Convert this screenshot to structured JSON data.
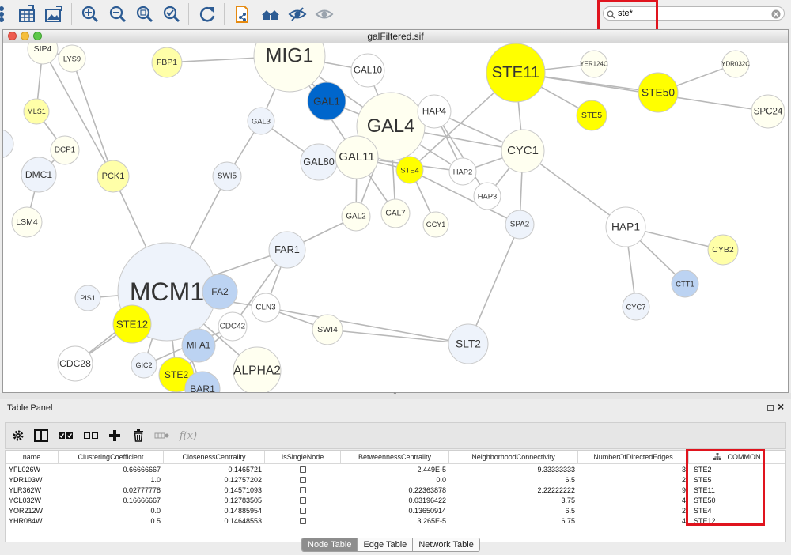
{
  "search": {
    "value": "ste*",
    "placeholder": ""
  },
  "network_window": {
    "title": "galFiltered.sif"
  },
  "colors": {
    "yellow": "#ffff00",
    "pale_yellow": "#ffffa8",
    "cream": "#fffff0",
    "pale_blue": "#eef3fb",
    "light_blue": "#bcd3f2",
    "blue": "#0066cc",
    "white": "#ffffff"
  },
  "network": {
    "nodes": [
      {
        "id": "SIP4",
        "label": "SIP4",
        "color": "cream"
      },
      {
        "id": "LYS9",
        "label": "LYS9",
        "color": "cream"
      },
      {
        "id": "FBP1",
        "label": "FBP1",
        "color": "pale_yellow"
      },
      {
        "id": "MIG1",
        "label": "MIG1",
        "color": "cream"
      },
      {
        "id": "GAL10",
        "label": "GAL10",
        "color": "white"
      },
      {
        "id": "GAL1",
        "label": "GAL1",
        "color": "blue"
      },
      {
        "id": "GAL4",
        "label": "GAL4",
        "color": "cream"
      },
      {
        "id": "HAP4",
        "label": "HAP4",
        "color": "white"
      },
      {
        "id": "GAL3",
        "label": "GAL3",
        "color": "pale_blue"
      },
      {
        "id": "GAL80",
        "label": "GAL80",
        "color": "pale_blue"
      },
      {
        "id": "GAL11",
        "label": "GAL11",
        "color": "cream"
      },
      {
        "id": "STE4",
        "label": "STE4",
        "color": "yellow"
      },
      {
        "id": "HAP2",
        "label": "HAP2",
        "color": "white"
      },
      {
        "id": "HAP3",
        "label": "HAP3",
        "color": "white"
      },
      {
        "id": "CYC1",
        "label": "CYC1",
        "color": "cream"
      },
      {
        "id": "STE11",
        "label": "STE11",
        "color": "yellow"
      },
      {
        "id": "YER124C",
        "label": "YER124C",
        "color": "cream"
      },
      {
        "id": "YDR032C",
        "label": "YDR032C",
        "color": "cream"
      },
      {
        "id": "STE50",
        "label": "STE50",
        "color": "yellow"
      },
      {
        "id": "STE5",
        "label": "STE5",
        "color": "yellow"
      },
      {
        "id": "SPC24",
        "label": "SPC24",
        "color": "cream"
      },
      {
        "id": "MLS1",
        "label": "MLS1",
        "color": "pale_yellow"
      },
      {
        "id": "DCP1",
        "label": "DCP1",
        "color": "cream"
      },
      {
        "id": "DMC1",
        "label": "DMC1",
        "color": "pale_blue"
      },
      {
        "id": "PCK1",
        "label": "PCK1",
        "color": "pale_yellow"
      },
      {
        "id": "SWI5",
        "label": "SWI5",
        "color": "pale_blue"
      },
      {
        "id": "LSM4",
        "label": "LSM4",
        "color": "cream"
      },
      {
        "id": "GAL2",
        "label": "GAL2",
        "color": "cream"
      },
      {
        "id": "GAL7",
        "label": "GAL7",
        "color": "cream"
      },
      {
        "id": "GCY1",
        "label": "GCY1",
        "color": "cream"
      },
      {
        "id": "SPA2",
        "label": "SPA2",
        "color": "pale_blue"
      },
      {
        "id": "HAP1",
        "label": "HAP1",
        "color": "white"
      },
      {
        "id": "CYB2",
        "label": "CYB2",
        "color": "pale_yellow"
      },
      {
        "id": "FAR1",
        "label": "FAR1",
        "color": "pale_blue"
      },
      {
        "id": "MCM1",
        "label": "MCM1",
        "color": "pale_blue"
      },
      {
        "id": "MFA2",
        "label": "FA2",
        "color": "light_blue"
      },
      {
        "id": "PIS1",
        "label": "PIS1",
        "color": "pale_blue"
      },
      {
        "id": "STE12",
        "label": "STE12",
        "color": "yellow"
      },
      {
        "id": "CLN3",
        "label": "CLN3",
        "color": "white"
      },
      {
        "id": "CDC42",
        "label": "CDC42",
        "color": "white"
      },
      {
        "id": "MFA1",
        "label": "MFA1",
        "color": "light_blue"
      },
      {
        "id": "SWI4",
        "label": "SWI4",
        "color": "cream"
      },
      {
        "id": "SLT2",
        "label": "SLT2",
        "color": "pale_blue"
      },
      {
        "id": "CTT1",
        "label": "CTT1",
        "color": "light_blue"
      },
      {
        "id": "CYC7",
        "label": "CYC7",
        "color": "pale_blue"
      },
      {
        "id": "CDC28",
        "label": "CDC28",
        "color": "white"
      },
      {
        "id": "GIC2",
        "label": "GIC2",
        "color": "pale_blue"
      },
      {
        "id": "STE2",
        "label": "STE2",
        "color": "yellow"
      },
      {
        "id": "ALPHA2",
        "label": "ALPHA2",
        "color": "cream"
      },
      {
        "id": "BAR1",
        "label": "BAR1",
        "color": "light_blue"
      },
      {
        "id": "B_partial",
        "label": "B",
        "color": "pale_blue"
      }
    ],
    "edges": [
      [
        "SIP4",
        "LYS9"
      ],
      [
        "MIG1",
        "GAL10"
      ],
      [
        "MIG1",
        "GAL1"
      ],
      [
        "MIG1",
        "GAL4"
      ],
      [
        "MIG1",
        "GAL3"
      ],
      [
        "MIG1",
        "GAL11"
      ],
      [
        "GAL4",
        "GAL1"
      ],
      [
        "GAL4",
        "GAL10"
      ],
      [
        "GAL4",
        "HAP4"
      ],
      [
        "GAL4",
        "GAL80"
      ],
      [
        "GAL4",
        "GAL11"
      ],
      [
        "GAL4",
        "STE4"
      ],
      [
        "GAL4",
        "GAL2"
      ],
      [
        "GAL4",
        "GAL7"
      ],
      [
        "GAL4",
        "GCY1"
      ],
      [
        "GAL4",
        "CYC1"
      ],
      [
        "GAL4",
        "HAP2"
      ],
      [
        "GAL11",
        "GAL80"
      ],
      [
        "GAL11",
        "GAL2"
      ],
      [
        "GAL11",
        "GAL7"
      ],
      [
        "GAL11",
        "STE4"
      ],
      [
        "GAL11",
        "HAP2"
      ],
      [
        "HAP4",
        "HAP2"
      ],
      [
        "HAP4",
        "HAP3"
      ],
      [
        "HAP4",
        "CYC1"
      ],
      [
        "HAP2",
        "CYC1"
      ],
      [
        "HAP3",
        "CYC1"
      ],
      [
        "CYC1",
        "HAP1"
      ],
      [
        "CYC1",
        "SPA2"
      ],
      [
        "CYC1",
        "STE11"
      ],
      [
        "STE11",
        "STE5"
      ],
      [
        "STE11",
        "STE50"
      ],
      [
        "STE11",
        "YER124C"
      ],
      [
        "STE11",
        "SPC24"
      ],
      [
        "STE11",
        "STE4"
      ],
      [
        "STE50",
        "YDR032C"
      ],
      [
        "HAP1",
        "CYB2"
      ],
      [
        "HAP1",
        "CTT1"
      ],
      [
        "HAP1",
        "CYC7"
      ],
      [
        "SPA2",
        "SLT2"
      ],
      [
        "FAR1",
        "MCM1"
      ],
      [
        "FAR1",
        "CLN3"
      ],
      [
        "FAR1",
        "GAL2"
      ],
      [
        "FAR1",
        "CDC42"
      ],
      [
        "MCM1",
        "SWI5"
      ],
      [
        "MCM1",
        "PCK1"
      ],
      [
        "MCM1",
        "MFA2"
      ],
      [
        "MCM1",
        "STE12"
      ],
      [
        "MCM1",
        "PIS1"
      ],
      [
        "MCM1",
        "CLN3"
      ],
      [
        "MCM1",
        "MFA1"
      ],
      [
        "MCM1",
        "STE2"
      ],
      [
        "MCM1",
        "ALPHA2"
      ],
      [
        "MCM1",
        "BAR1"
      ],
      [
        "MCM1",
        "CDC28"
      ],
      [
        "MCM1",
        "GIC2"
      ],
      [
        "CLN3",
        "SWI4"
      ],
      [
        "CLN3",
        "SLT2"
      ],
      [
        "SWI4",
        "SLT2"
      ],
      [
        "CDC42",
        "STE2"
      ],
      [
        "CDC42",
        "GIC2"
      ],
      [
        "STE12",
        "CDC28"
      ],
      [
        "DCP1",
        "DMC1"
      ],
      [
        "DMC1",
        "LSM4"
      ],
      [
        "MLS1",
        "DCP1"
      ],
      [
        "SIP4",
        "MLS1"
      ],
      [
        "SIP4",
        "PCK1"
      ],
      [
        "LYS9",
        "PCK1"
      ],
      [
        "FBP1",
        "MIG1"
      ],
      [
        "SWI5",
        "GAL3"
      ],
      [
        "GAL3",
        "GAL80"
      ],
      [
        "SPA2",
        "STE4"
      ]
    ]
  },
  "table_panel": {
    "title": "Table Panel",
    "columns": [
      "name",
      "ClusteringCoefficient",
      "ClosenessCentrality",
      "IsSingleNode",
      "BetweennessCentrality",
      "NeighborhoodConnectivity",
      "NumberOfDirectedEdges",
      "COMMON"
    ],
    "rows": [
      {
        "name": "YFL026W",
        "cc": "0.66666667",
        "clos": "0.1465721",
        "single": false,
        "betw": "2.449E-5",
        "nconn": "9.33333333",
        "nde": "3",
        "common": "STE2"
      },
      {
        "name": "YDR103W",
        "cc": "1.0",
        "clos": "0.12757202",
        "single": false,
        "betw": "0.0",
        "nconn": "6.5",
        "nde": "2",
        "common": "STE5"
      },
      {
        "name": "YLR362W",
        "cc": "0.02777778",
        "clos": "0.14571093",
        "single": false,
        "betw": "0.22363878",
        "nconn": "2.22222222",
        "nde": "9",
        "common": "STE11"
      },
      {
        "name": "YCL032W",
        "cc": "0.16666667",
        "clos": "0.12783505",
        "single": false,
        "betw": "0.03196422",
        "nconn": "3.75",
        "nde": "4",
        "common": "STE50"
      },
      {
        "name": "YOR212W",
        "cc": "0.0",
        "clos": "0.14885954",
        "single": false,
        "betw": "0.13650914",
        "nconn": "6.5",
        "nde": "2",
        "common": "STE4"
      },
      {
        "name": "YHR084W",
        "cc": "0.5",
        "clos": "0.14648553",
        "single": false,
        "betw": "3.265E-5",
        "nconn": "6.75",
        "nde": "4",
        "common": "STE12"
      }
    ],
    "toolbar": {
      "function_label": "f(x)"
    },
    "tabs": [
      {
        "label": "Node Table",
        "active": true
      },
      {
        "label": "Edge Table",
        "active": false
      },
      {
        "label": "Network Table",
        "active": false
      }
    ]
  }
}
